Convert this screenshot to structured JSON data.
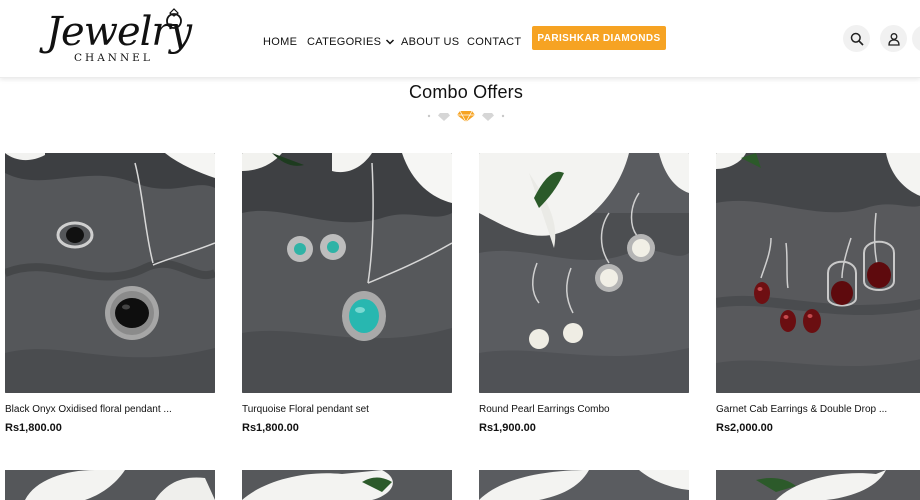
{
  "brand": {
    "name": "Jewelry",
    "sub": "CHANNEL"
  },
  "nav": {
    "home": "HOME",
    "categories": "CATEGORIES",
    "about": "ABOUT US",
    "contact": "CONTACT",
    "cta": "PARISHKAR DIAMONDS"
  },
  "colors": {
    "accent": "#f6a323",
    "wood": "#5a5a5a"
  },
  "section": {
    "title": "Combo Offers"
  },
  "products": [
    {
      "name": "Black Onyx Oxidised floral pendant ...",
      "price": "Rs1,800.00"
    },
    {
      "name": "Turquoise Floral pendant set",
      "price": "Rs1,800.00"
    },
    {
      "name": "Round Pearl Earrings Combo",
      "price": "Rs1,900.00"
    },
    {
      "name": "Garnet Cab Earrings & Double Drop ...",
      "price": "Rs2,000.00"
    }
  ],
  "icons": [
    "search-icon",
    "user-icon",
    "chevron-down-icon",
    "diamond-icon"
  ]
}
